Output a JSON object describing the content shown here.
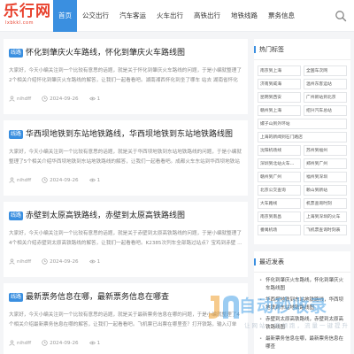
{
  "site": {
    "logo_text": "乐行网",
    "logo_sub": "lxbkkl.com"
  },
  "nav": {
    "items": [
      {
        "label": "首页"
      },
      {
        "label": "公交出行"
      },
      {
        "label": "汽车客运"
      },
      {
        "label": "火车出行"
      },
      {
        "label": "高铁出行"
      },
      {
        "label": "地铁线路"
      },
      {
        "label": "票务信息"
      }
    ]
  },
  "colors": {
    "accent": "#3a8fe0",
    "logo": "#e8412d"
  },
  "posts": [
    {
      "tag": "线路",
      "title": "怀化到肇庆火车路线，怀化到肇庆火车路线图",
      "excerpt": "大家好，今天小编关注到一个比较有意思的话题，就是关于怀化到肇庆火车路线的问题，于是小编就整理了2个相关介绍怀化到肇庆火车路线的解答，让我们一起看看吧。湖南湘西怀化到坐了哪车 站去 湖南省怀化市 到 ...",
      "author": "nihdff",
      "date": "2024-09-26",
      "views": "1"
    },
    {
      "tag": "线路",
      "title": "华西坝地铁到东站地铁路线，华西坝地铁到东站地铁路线图",
      "excerpt": "大家好，今天小编关注到一个比较有意思的话题，就是关于华西坝地铁到东站地铁路线的问题，于是小编就整理了5个相关介绍华西坝地铁到东站地铁路线的解答，让我们一起看看吧。成都火车东站到华西坝地铁站步行需多久 ...",
      "author": "nihdff",
      "date": "2024-09-26",
      "views": "1"
    },
    {
      "tag": "线路",
      "title": "赤壁到太原高铁路线，赤壁到太原高铁路线图",
      "excerpt": "大家好，今天小编关注到一个比较有意思的话题，就是关于赤壁到太原高铁路线的问题，于是小编就整理了4个相关介绍赤壁到太原高铁路线的解答，让我们一起看看吧。K2385次列车全部路过站点？宝鸡到赤壁 ...",
      "author": "nihdff",
      "date": "2024-09-26",
      "views": "1"
    },
    {
      "tag": "线路",
      "title": "最新票务信息在哪，最新票务信息在哪查",
      "excerpt": "大家好，今天小编关注到一个比较有意思的话题，就是关于最新票务信息在哪的问题，于是小编就整理了4个相关介绍最新票务信息在哪的解答，让我们一起看看吧。飞机票已出票在哪里查？打开铁路，输入订单号，选择…",
      "author": "nihdff",
      "date": "2024-09-26",
      "views": "1"
    }
  ],
  "sidebar": {
    "hot_tags_title": "热门标签",
    "hot_tags": [
      "南京到上海",
      "全国车次网",
      "济南到威海",
      "温州东客运站",
      "昆明到西安",
      "广州新站到北京",
      "赣州到上海",
      "绍兴汽车总站",
      "嫘子山到外环站",
      "上海的新闻到石门路店",
      "沈阳机场线",
      "苏州到福州",
      "深圳到北站火车路线",
      "郑州到广州",
      "赣州到广州",
      "福州到深圳",
      "北京公交查询",
      "赖山到新站",
      "大车路线",
      "机票查询时刻",
      "南京到南昌",
      "上海到深圳的火车",
      "番禺机场",
      "飞机票查询时刻表"
    ],
    "recent_title": "最近发表",
    "recent": [
      "怀化到肇庆火车路线，怀化到肇庆火车路线图",
      "华西坝地铁到东站地铁路线，华西坝地铁到东站地铁路线图",
      "赤壁到太原高铁路线，赤壁到太原高铁路线图",
      "最新票务信息在哪，最新票务信息在哪查"
    ]
  },
  "watermark": {
    "text": "自动秒收录",
    "sub": "让网站一路领跑，流量一键提升"
  }
}
